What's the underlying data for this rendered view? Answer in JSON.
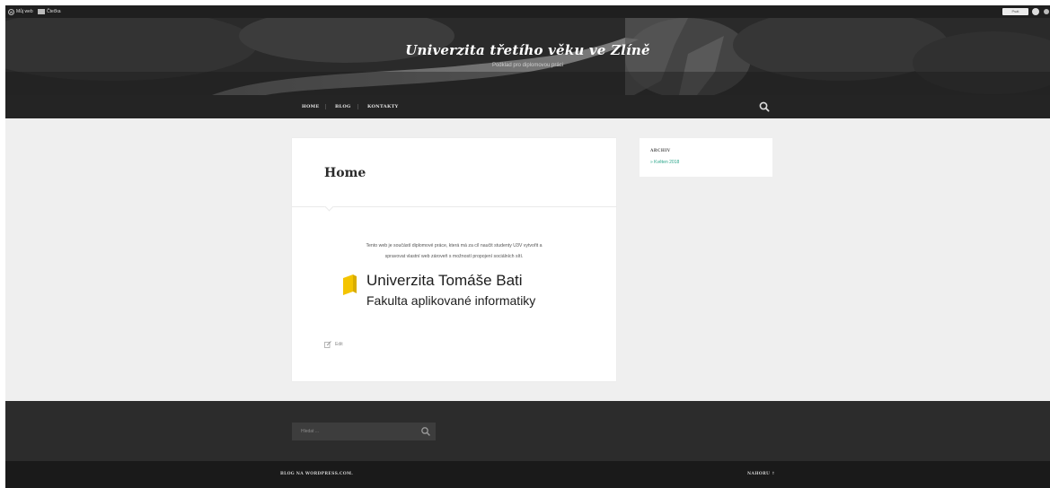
{
  "admin_bar": {
    "my_site": "Můj web",
    "reader": "Čtečka",
    "write_label": "Psát"
  },
  "header": {
    "title": "Univerzita třetího věku ve Zlíně",
    "description": "Podklad pro diplomovou práci"
  },
  "nav": {
    "items": [
      "HOME",
      "BLOG",
      "KONTAKTY"
    ],
    "search_icon": "search-icon"
  },
  "content": {
    "title": "Home",
    "intro_line1": "Tento web je součástí diplomové práce, která má za cíl naučit studenty U3V vytvořit a",
    "intro_line2": "spravovat vlastní web zároveň s možností propojení sociálních sítí.",
    "logo_line1": "Univerzita Tomáše Bati",
    "logo_line2": "Fakulta aplikované informatiky",
    "logo_color": "#f4c400",
    "edit_label": "Edit"
  },
  "sidebar": {
    "widget_title": "ARCHIV",
    "archive_link": "» Květen 2018",
    "link_color": "#2aa58a"
  },
  "footer": {
    "search_placeholder": "Hledat ...",
    "credit": "BLOG NA WORDPRESS.COM.",
    "back_to_top": "NAHORU ↑"
  }
}
